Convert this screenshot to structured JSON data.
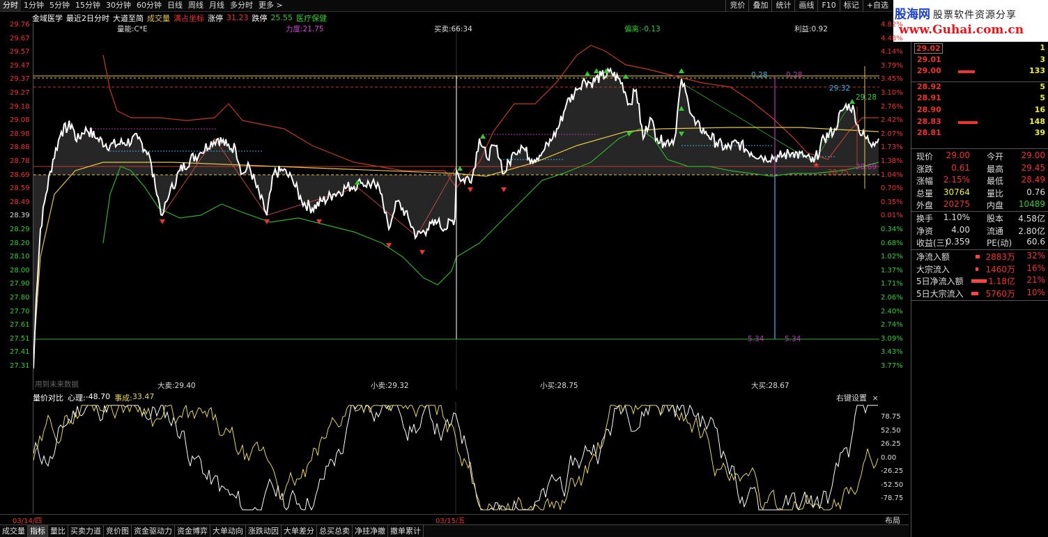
{
  "toolbar": {
    "tabs": [
      "分时",
      "1分钟",
      "5分钟",
      "15分钟",
      "30分钟",
      "60分钟",
      "日线",
      "周线",
      "月线",
      "多分时",
      "更多 >"
    ],
    "right": [
      "竞价",
      "叠加",
      "统计",
      "画线",
      "F10",
      "标记",
      "+自选"
    ]
  },
  "brand": {
    "name": "股海网",
    "tagline": "股票软件资源分享",
    "url": "www.Guhai.com.cn"
  },
  "chart_header": {
    "name": "金域医学",
    "mode": "最近2日分时",
    "simplify": "大道至简",
    "volume": "成交量",
    "coord": "满占坐标",
    "limit_up_label": "涨停",
    "limit_up": "31.23",
    "limit_down_label": "跌停",
    "limit_down": "25.55",
    "sector": "医疗保健"
  },
  "overlay_labels": {
    "liangneng": "量能:C*E",
    "lidu": "力度:21.75",
    "maimai": "买卖:66:34",
    "pianli": "偏离:-0.13",
    "liyi": "利益:0.92",
    "dmai": "大卖:29.40",
    "xmai": "小卖:29.32",
    "xmaiin": "小买:28.75",
    "dmaiin": "大买:28.67",
    "future": "用到未来数据",
    "v1": "0.28",
    "v2": "0.28",
    "v3": "29.32",
    "v4": "29.28",
    "v5": "28.75",
    "v6": "28.69",
    "v7": "5.34",
    "v8": "5.34"
  },
  "price_axis": [
    "29.76",
    "29.67",
    "29.57",
    "29.47",
    "29.37",
    "29.27",
    "29.18",
    "29.08",
    "28.98",
    "28.88",
    "28.78",
    "28.69",
    "28.59",
    "28.49",
    "28.39",
    "28.29",
    "28.20",
    "28.10",
    "28.00",
    "27.90",
    "27.80",
    "27.70",
    "27.61",
    "27.51",
    "27.41",
    "27.31"
  ],
  "pct_axis": [
    "4.82%",
    "4.48%",
    "4.14%",
    "3.79%",
    "3.45%",
    "3.10%",
    "2.76%",
    "2.42%",
    "2.07%",
    "1.73%",
    "1.38%",
    "1.04%",
    "0.70%",
    "0.35%",
    "0.01%",
    "0.34%",
    "0.68%",
    "1.02%",
    "1.37%",
    "1.71%",
    "2.06%",
    "2.40%",
    "2.74%",
    "3.09%",
    "3.43%",
    "3.77%"
  ],
  "sub_header": {
    "name": "量价对比",
    "xinli_label": "心理:",
    "xinli": "-48.70",
    "shicheng_label": "事成:",
    "shicheng": "33.47",
    "settings": "右键设置",
    "close": "×"
  },
  "sub_axis": [
    "78.75",
    "52.50",
    "26.25",
    "0.00",
    "-26.25",
    "-52.50",
    "-78.75"
  ],
  "dates": {
    "d1": "03/14/四",
    "d2": "03/15/五",
    "layout": "布局"
  },
  "bottom_tabs": [
    "成交量",
    "指标",
    "量比",
    "买卖力道",
    "竞价图",
    "资金驱动力",
    "资金博弈",
    "大单动向",
    "涨跌动因",
    "大单差分",
    "总买总卖",
    "净挂净撤",
    "撤单累计"
  ],
  "order_book": [
    {
      "price": "29.02",
      "vol": "1",
      "bar": 0
    },
    {
      "price": "29.01",
      "vol": "3",
      "bar": 0
    },
    {
      "price": "29.00",
      "vol": "133",
      "bar": 24
    },
    {
      "price": "28.92",
      "vol": "5",
      "bar": 0
    },
    {
      "price": "28.91",
      "vol": "5",
      "bar": 0
    },
    {
      "price": "28.90",
      "vol": "16",
      "bar": 0
    },
    {
      "price": "28.83",
      "vol": "148",
      "bar": 28
    },
    {
      "price": "28.81",
      "vol": "39",
      "bar": 0
    }
  ],
  "quote": [
    {
      "l1": "现价",
      "v1": "29.00",
      "l2": "今开",
      "v2": "29.00"
    },
    {
      "l1": "涨跌",
      "v1": "0.61",
      "l2": "最高",
      "v2": "29.45"
    },
    {
      "l1": "涨幅",
      "v1": "2.15%",
      "l2": "最低",
      "v2": "28.49"
    },
    {
      "l1": "总量",
      "v1": "30764",
      "l2": "量比",
      "v2": "0.76"
    },
    {
      "l1": "外盘",
      "v1": "20275",
      "l2": "内盘",
      "v2": "10489"
    }
  ],
  "quote2": [
    {
      "l1": "换手",
      "v1": "1.10%",
      "l2": "股本",
      "v2": "4.58亿"
    },
    {
      "l1": "净资",
      "v1": "4.00",
      "l2": "流通",
      "v2": "2.80亿"
    },
    {
      "l1": "收益(三)",
      "v1": "0.359",
      "l2": "PE(动)",
      "v2": "60.6"
    }
  ],
  "flows": [
    {
      "label": "净流入额",
      "val": "2883万",
      "pct": "32%",
      "bar": 6
    },
    {
      "label": "大宗流入",
      "val": "1460万",
      "pct": "16%",
      "bar": 4
    },
    {
      "label": "5日净流入额",
      "val": "1.18亿",
      "pct": "21%",
      "bar": 22
    },
    {
      "label": "5日大宗流入",
      "val": "5760万",
      "pct": "10%",
      "bar": 10
    }
  ],
  "colors": {
    "up": "#e33",
    "down": "#3c3",
    "price_line": "#ffffff",
    "avg_line": "#e6c84a",
    "bull": "#c0392b",
    "sub_white": "#ffffff",
    "sub_yellow": "#e6d46a"
  }
}
